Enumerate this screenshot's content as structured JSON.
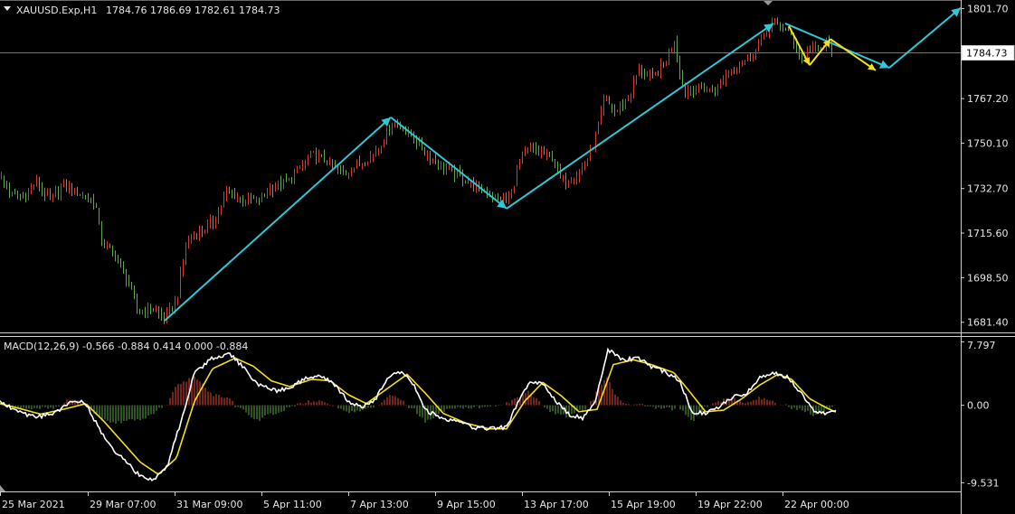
{
  "header": {
    "symbol": "XAUUSD.Exp,H1",
    "ohlc": "1784.76 1786.69 1782.61 1784.73"
  },
  "macd_header": {
    "text": "MACD(12,26,9) -0.566 -0.884 0.414 0.000 -0.884"
  },
  "colors": {
    "background": "#000000",
    "bull_candle": "#d33a2b",
    "bear_candle": "#5fa84a",
    "trend_arrow": "#2ec8d6",
    "short_arrow": "#f2e01c",
    "macd_line": "#ffffff",
    "signal_line": "#f2e01c",
    "hist_up": "#c03a2b",
    "hist_down": "#4f8a3a",
    "axis_text": "#e6e6e6",
    "current_price_line": "#9a9a9a"
  },
  "chart_data": [
    {
      "type": "candlestick",
      "title": "",
      "ylabel": "",
      "y_ticks": [
        1801.7,
        1784.73,
        1767.2,
        1750.1,
        1732.7,
        1715.6,
        1698.5,
        1681.4
      ],
      "y_tick_labels": [
        "1801.70",
        "1784.73",
        "1767.20",
        "1750.10",
        "1732.70",
        "1715.60",
        "1698.50",
        "1681.40"
      ],
      "current_price": 1784.73,
      "current_price_label": "1784.73",
      "ylim": [
        1677.5,
        1805
      ],
      "x_tick_labels": [
        "25 Mar 2021",
        "29 Mar 07:00",
        "31 Mar 09:00",
        "5 Apr 11:00",
        "7 Apr 13:00",
        "9 Apr 15:00",
        "13 Apr 17:00",
        "15 Apr 19:00",
        "19 Apr 22:00",
        "22 Apr 00:00"
      ],
      "close_anchors": [
        [
          0,
          1737
        ],
        [
          12,
          1730
        ],
        [
          25,
          1729
        ],
        [
          40,
          1735
        ],
        [
          55,
          1728
        ],
        [
          70,
          1734
        ],
        [
          90,
          1730
        ],
        [
          105,
          1727
        ],
        [
          112,
          1712
        ],
        [
          125,
          1708
        ],
        [
          140,
          1698
        ],
        [
          152,
          1685
        ],
        [
          165,
          1687
        ],
        [
          182,
          1683
        ],
        [
          195,
          1690
        ],
        [
          205,
          1712
        ],
        [
          220,
          1716
        ],
        [
          235,
          1720
        ],
        [
          250,
          1731
        ],
        [
          265,
          1729
        ],
        [
          285,
          1728
        ],
        [
          300,
          1733
        ],
        [
          320,
          1736
        ],
        [
          345,
          1746
        ],
        [
          360,
          1743
        ],
        [
          380,
          1738
        ],
        [
          395,
          1742
        ],
        [
          410,
          1745
        ],
        [
          425,
          1752
        ],
        [
          432,
          1758
        ],
        [
          445,
          1756
        ],
        [
          460,
          1751
        ],
        [
          470,
          1746
        ],
        [
          485,
          1742
        ],
        [
          500,
          1739
        ],
        [
          515,
          1736
        ],
        [
          530,
          1732
        ],
        [
          545,
          1730
        ],
        [
          555,
          1728
        ],
        [
          565,
          1730
        ],
        [
          572,
          1742
        ],
        [
          585,
          1748
        ],
        [
          600,
          1746
        ],
        [
          612,
          1744
        ],
        [
          620,
          1735
        ],
        [
          635,
          1737
        ],
        [
          650,
          1744
        ],
        [
          660,
          1755
        ],
        [
          668,
          1767
        ],
        [
          680,
          1762
        ],
        [
          695,
          1768
        ],
        [
          705,
          1778
        ],
        [
          720,
          1775
        ],
        [
          735,
          1781
        ],
        [
          745,
          1790
        ],
        [
          755,
          1770
        ],
        [
          770,
          1771
        ],
        [
          790,
          1770
        ],
        [
          805,
          1778
        ],
        [
          820,
          1781
        ],
        [
          835,
          1786
        ],
        [
          845,
          1793
        ],
        [
          855,
          1796
        ],
        [
          865,
          1795
        ],
        [
          875,
          1791
        ],
        [
          885,
          1782
        ],
        [
          895,
          1787
        ],
        [
          905,
          1786
        ],
        [
          915,
          1789
        ],
        [
          920,
          1784.73
        ]
      ],
      "trend_arrows": [
        {
          "from": [
            182,
            1682
          ],
          "to": [
            432,
            1760
          ]
        },
        {
          "from": [
            432,
            1760
          ],
          "to": [
            560,
            1725
          ]
        },
        {
          "from": [
            560,
            1725
          ],
          "to": [
            855,
            1796
          ]
        },
        {
          "from": [
            868,
            1796
          ],
          "to": [
            983,
            1779
          ]
        },
        {
          "from": [
            983,
            1779
          ],
          "to": [
            1062,
            1802
          ]
        }
      ],
      "short_arrows": [
        {
          "from": [
            872,
            1795
          ],
          "to": [
            895,
            1780
          ]
        },
        {
          "from": [
            895,
            1780
          ],
          "to": [
            918,
            1790
          ]
        },
        {
          "from": [
            918,
            1790
          ],
          "to": [
            968,
            1778
          ]
        }
      ]
    },
    {
      "type": "macd",
      "title": "MACD(12,26,9)",
      "y_tick_labels": [
        "7.797",
        "0.00",
        "-9.531"
      ],
      "y_ticks": [
        7.797,
        0.0,
        -9.531
      ],
      "ylim": [
        -10.6,
        8.4
      ],
      "macd_anchors": [
        [
          0,
          0.5
        ],
        [
          20,
          -0.8
        ],
        [
          40,
          -1.5
        ],
        [
          60,
          -1.0
        ],
        [
          80,
          0.6
        ],
        [
          95,
          0.2
        ],
        [
          110,
          -3.0
        ],
        [
          125,
          -5.5
        ],
        [
          140,
          -7.0
        ],
        [
          155,
          -8.8
        ],
        [
          170,
          -9.3
        ],
        [
          185,
          -7.5
        ],
        [
          200,
          -2.0
        ],
        [
          215,
          4.0
        ],
        [
          235,
          5.8
        ],
        [
          255,
          6.3
        ],
        [
          270,
          4.5
        ],
        [
          285,
          2.5
        ],
        [
          305,
          1.8
        ],
        [
          320,
          2.0
        ],
        [
          340,
          3.5
        ],
        [
          355,
          3.7
        ],
        [
          370,
          2.5
        ],
        [
          385,
          0.5
        ],
        [
          400,
          -0.3
        ],
        [
          415,
          0.8
        ],
        [
          430,
          3.5
        ],
        [
          445,
          4.1
        ],
        [
          455,
          3.0
        ],
        [
          470,
          -0.5
        ],
        [
          485,
          -1.5
        ],
        [
          505,
          -2.1
        ],
        [
          525,
          -2.8
        ],
        [
          545,
          -2.9
        ],
        [
          560,
          -2.7
        ],
        [
          570,
          -0.2
        ],
        [
          585,
          2.8
        ],
        [
          600,
          2.6
        ],
        [
          615,
          0.5
        ],
        [
          630,
          -1.2
        ],
        [
          645,
          -1.6
        ],
        [
          658,
          0.6
        ],
        [
          672,
          6.9
        ],
        [
          688,
          5.6
        ],
        [
          705,
          5.8
        ],
        [
          720,
          4.8
        ],
        [
          735,
          4.1
        ],
        [
          750,
          3.2
        ],
        [
          765,
          -0.8
        ],
        [
          780,
          -1.0
        ],
        [
          795,
          -0.2
        ],
        [
          810,
          1.0
        ],
        [
          825,
          1.5
        ],
        [
          840,
          3.4
        ],
        [
          855,
          4.0
        ],
        [
          870,
          3.5
        ],
        [
          885,
          1.5
        ],
        [
          900,
          -0.9
        ],
        [
          912,
          -1.0
        ],
        [
          925,
          -0.566
        ]
      ],
      "signal_anchors": [
        [
          0,
          0.2
        ],
        [
          25,
          -0.5
        ],
        [
          45,
          -1.1
        ],
        [
          70,
          -0.5
        ],
        [
          95,
          0.2
        ],
        [
          115,
          -2.0
        ],
        [
          135,
          -4.5
        ],
        [
          155,
          -7.0
        ],
        [
          175,
          -8.5
        ],
        [
          195,
          -6.5
        ],
        [
          215,
          0.5
        ],
        [
          235,
          4.5
        ],
        [
          260,
          5.8
        ],
        [
          280,
          4.8
        ],
        [
          300,
          3.0
        ],
        [
          320,
          2.3
        ],
        [
          345,
          3.2
        ],
        [
          365,
          3.0
        ],
        [
          385,
          1.3
        ],
        [
          405,
          0.2
        ],
        [
          425,
          1.8
        ],
        [
          450,
          3.8
        ],
        [
          470,
          1.5
        ],
        [
          490,
          -1.0
        ],
        [
          515,
          -2.2
        ],
        [
          540,
          -2.9
        ],
        [
          560,
          -2.9
        ],
        [
          580,
          0.5
        ],
        [
          600,
          2.8
        ],
        [
          620,
          1.2
        ],
        [
          640,
          -0.8
        ],
        [
          660,
          -0.5
        ],
        [
          678,
          5.0
        ],
        [
          700,
          5.6
        ],
        [
          720,
          5.0
        ],
        [
          745,
          4.0
        ],
        [
          760,
          2.0
        ],
        [
          780,
          -0.8
        ],
        [
          800,
          -0.6
        ],
        [
          820,
          0.8
        ],
        [
          840,
          2.5
        ],
        [
          860,
          3.8
        ],
        [
          875,
          3.2
        ],
        [
          895,
          0.8
        ],
        [
          915,
          -0.4
        ],
        [
          925,
          -0.884
        ]
      ]
    }
  ]
}
